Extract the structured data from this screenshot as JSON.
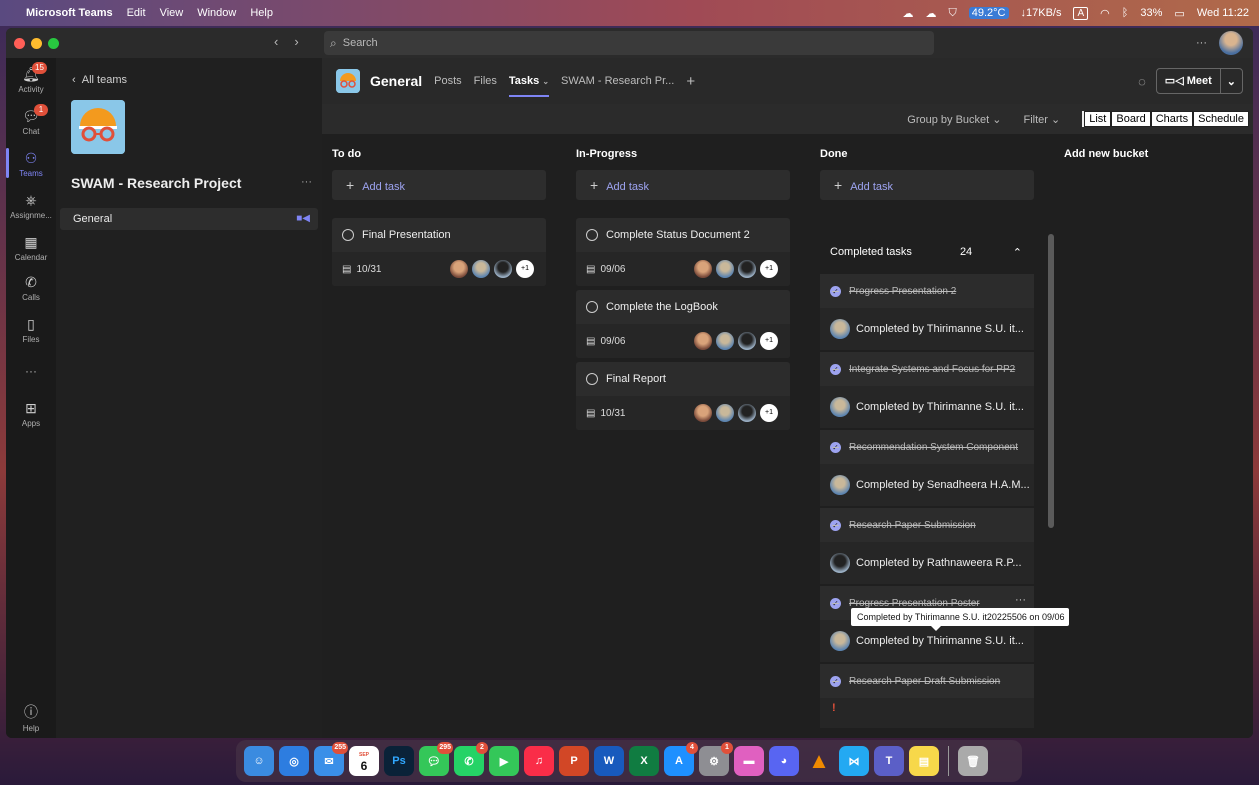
{
  "menubar": {
    "app_name": "Microsoft Teams",
    "menus": [
      "Edit",
      "View",
      "Window",
      "Help"
    ],
    "temperature": "49.2°C",
    "network": "↓17KB/s",
    "input_source": "A",
    "battery": "33%",
    "clock": "Wed 11:22"
  },
  "titlebar": {
    "search_placeholder": "Search",
    "more": "···"
  },
  "rail": {
    "items": [
      {
        "label": "Activity",
        "icon": "bell-icon",
        "badge": "15"
      },
      {
        "label": "Chat",
        "icon": "chat-icon",
        "badge": "1"
      },
      {
        "label": "Teams",
        "icon": "teams-icon"
      },
      {
        "label": "Assignme...",
        "icon": "assignments-icon"
      },
      {
        "label": "Calendar",
        "icon": "calendar-icon"
      },
      {
        "label": "Calls",
        "icon": "phone-icon"
      },
      {
        "label": "Files",
        "icon": "file-icon"
      },
      {
        "label": "···",
        "icon": "more-icon"
      },
      {
        "label": "Apps",
        "icon": "apps-icon"
      },
      {
        "label": "Help",
        "icon": "help-icon"
      }
    ]
  },
  "teampane": {
    "back_label": "All teams",
    "team_name": "SWAM - Research Project",
    "more": "···",
    "channel": "General"
  },
  "header": {
    "channel_title": "General",
    "tabs": [
      "Posts",
      "Files",
      "Tasks",
      "SWAM - Research Pr..."
    ],
    "add_tab": "+",
    "meet_label": "Meet"
  },
  "toolbar": {
    "group_by": "Group by Bucket",
    "filter": "Filter",
    "views": [
      "List",
      "Board",
      "Charts",
      "Schedule"
    ]
  },
  "buckets": [
    {
      "title": "To do",
      "add_label": "Add task",
      "tasks": [
        {
          "title": "Final Presentation",
          "date": "10/31",
          "more_assignees": "+1"
        }
      ]
    },
    {
      "title": "In-Progress",
      "add_label": "Add task",
      "tasks": [
        {
          "title": "Complete Status Document 2",
          "date": "09/06",
          "more_assignees": "+1"
        },
        {
          "title": "Complete the LogBook",
          "date": "09/06",
          "more_assignees": "+1"
        },
        {
          "title": "Final Report",
          "date": "10/31",
          "more_assignees": "+1"
        }
      ]
    },
    {
      "title": "Done",
      "add_label": "Add task",
      "completed_label": "Completed tasks",
      "completed_count": "24",
      "completed": [
        {
          "title": "Progress Presentation 2",
          "by": "Completed by Thirimanne S.U. it..."
        },
        {
          "title": "Integrate Systems and Focus for PP2",
          "by": "Completed by Thirimanne S.U. it..."
        },
        {
          "title": "Recommendation System Component",
          "by": "Completed by Senadheera H.A.M..."
        },
        {
          "title": "Research Paper Submission",
          "by": "Completed by Rathnaweera R.P..."
        },
        {
          "title": "Progress Presentation Poster",
          "by": "Completed by Thirimanne S.U. it..."
        },
        {
          "title": "Research Paper Draft Submission",
          "by": "!"
        }
      ]
    }
  ],
  "add_bucket": "Add new bucket",
  "tooltip": "Completed by Thirimanne S.U. it20225506 on 09/06",
  "dock": {
    "badges": {
      "mail": "255",
      "calendar_day": "6",
      "calendar_month": "SEP",
      "messages": "295",
      "whatsapp": "2",
      "appstore": "4",
      "settings": "1"
    }
  }
}
